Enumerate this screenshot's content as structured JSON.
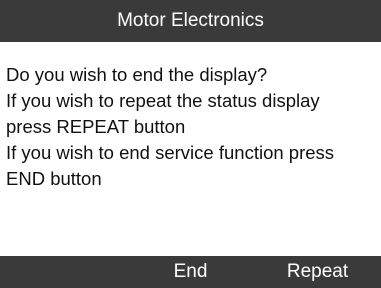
{
  "title": "Motor Electronics",
  "message_lines": [
    "Do you wish to end the display?",
    "If you wish to repeat the status display",
    "press REPEAT button",
    "If you wish to end service function press",
    "END button"
  ],
  "softkeys": {
    "left": "",
    "middle": "End",
    "right": "Repeat"
  },
  "colors": {
    "bar_background": "#3a3a3a",
    "bar_text": "#ffffff",
    "body_background": "#ffffff",
    "body_text": "#111111"
  }
}
